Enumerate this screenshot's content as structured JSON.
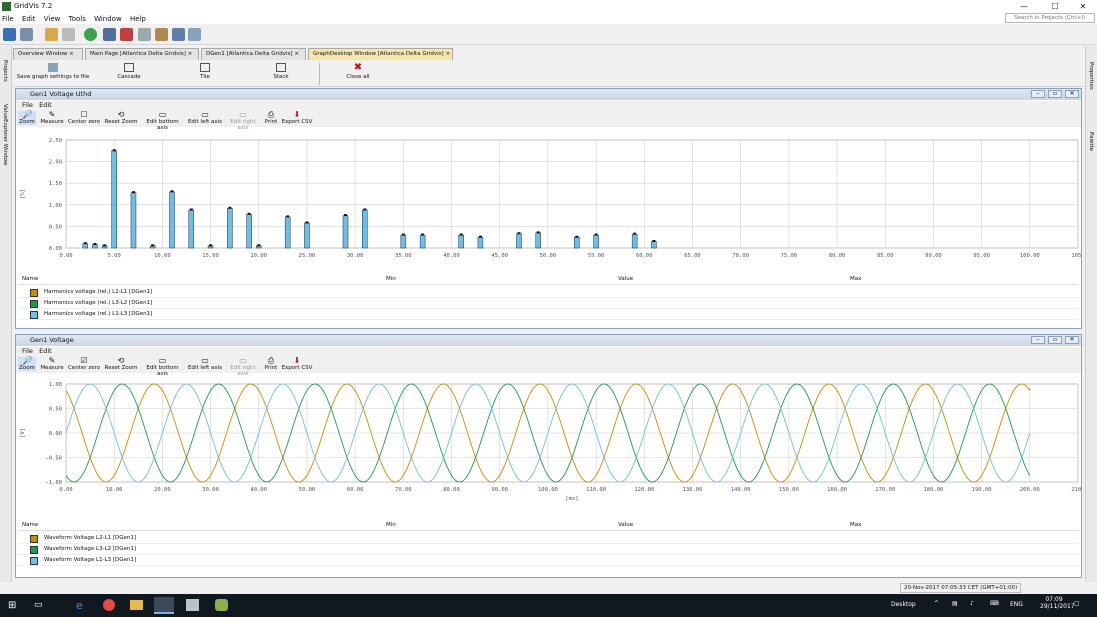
{
  "app": {
    "title": "GridVis 7.2",
    "close_glyph": "✕",
    "min_glyph": "—",
    "max_glyph": "☐"
  },
  "menu": [
    "File",
    "Edit",
    "View",
    "Tools",
    "Window",
    "Help"
  ],
  "search": {
    "placeholder": "Search in Projects (Ctrl+I)"
  },
  "left_strip": [
    "Projects",
    "ValueExplorer Window"
  ],
  "right_strip": [
    "Properties",
    "Palette"
  ],
  "tabs": [
    {
      "label": "Overview Window"
    },
    {
      "label": "Main Page [Atlantica Delta Gridvis]"
    },
    {
      "label": "DGen1 [Atlantica Delta Gridvis]"
    },
    {
      "label": "GraphDesktop Window [Atlantica Delta Gridvis]"
    }
  ],
  "tab_close": "×",
  "actions": [
    {
      "label": "Save graph settings to file"
    },
    {
      "label": "Cascade"
    },
    {
      "label": "Tile"
    },
    {
      "label": "Stack"
    },
    {
      "label": "Close all"
    }
  ],
  "panel_menu": [
    "File",
    "Edit"
  ],
  "panel_tools": [
    {
      "label": "Zoom"
    },
    {
      "label": "Measure"
    },
    {
      "label": "Center zero"
    },
    {
      "label": "Reset Zoom"
    },
    {
      "label": "Edit bottom axis"
    },
    {
      "label": "Edit left axis"
    },
    {
      "label": "Edit right axis"
    },
    {
      "label": "Print"
    },
    {
      "label": "Export CSV"
    }
  ],
  "table_headers": [
    "Name",
    "Min",
    "Value",
    "Max"
  ],
  "colors": {
    "l1": "#c98c00",
    "l2": "#1e9a4a",
    "l3": "#6cc0e8",
    "accent": "#f7e6a9"
  },
  "panel1": {
    "title": "Gen1 Voltage Uthd",
    "legend": [
      {
        "name": "Harmonics voltage (rel.) L2-L1 [DGen1]",
        "color": "#c98c00"
      },
      {
        "name": "Harmonics voltage (rel.) L3-L2 [DGen1]",
        "color": "#1e9a4a"
      },
      {
        "name": "Harmonics voltage (rel.) L1-L3 [DGen1]",
        "color": "#6cc0e8"
      }
    ]
  },
  "panel2": {
    "title": "Gen1 Voltage",
    "legend": [
      {
        "name": "Waveform Voltage L2-L1 [DGen1]",
        "color": "#c98c00"
      },
      {
        "name": "Waveform Voltage L3-L2 [DGen1]",
        "color": "#1e9a4a"
      },
      {
        "name": "Waveform Voltage L1-L3 [DGen1]",
        "color": "#6cc0e8"
      }
    ]
  },
  "status": {
    "timestamp": "20-Nov-2017 07:05:33 CET (GMT+01:00)"
  },
  "taskbar": {
    "desktop": "Desktop",
    "lang": "ENG",
    "time": "07:09",
    "date": "29/11/2017"
  },
  "chart_data": [
    {
      "type": "bar",
      "title": "",
      "xlabel": "",
      "ylabel": "[%]",
      "xlim": [
        0,
        105
      ],
      "ylim": [
        0,
        2.5
      ],
      "x_ticks": [
        "0.00",
        "5.00",
        "10.00",
        "15.00",
        "20.00",
        "25.00",
        "30.00",
        "35.00",
        "40.00",
        "45.00",
        "50.00",
        "55.00",
        "60.00",
        "65.00",
        "70.00",
        "75.00",
        "80.00",
        "85.00",
        "90.00",
        "95.00",
        "100.00",
        "105."
      ],
      "y_ticks": [
        "0.00",
        "0.50",
        "1.00",
        "1.50",
        "2.00",
        "2.50"
      ],
      "x": [
        2,
        3,
        4,
        5,
        7,
        9,
        11,
        13,
        15,
        17,
        19,
        20,
        23,
        25,
        29,
        31,
        35,
        37,
        41,
        43,
        47,
        49,
        53,
        55,
        59,
        61
      ],
      "values": [
        0.1,
        0.08,
        0.05,
        2.25,
        1.28,
        0.05,
        1.3,
        0.88,
        0.05,
        0.92,
        0.78,
        0.05,
        0.72,
        0.58,
        0.75,
        0.88,
        0.3,
        0.3,
        0.3,
        0.25,
        0.33,
        0.35,
        0.25,
        0.3,
        0.32,
        0.15
      ],
      "grid": true
    },
    {
      "type": "line",
      "title": "",
      "xlabel": "[ms]",
      "ylabel": "[V]",
      "xlim": [
        0,
        210
      ],
      "ylim": [
        -1.0,
        1.0
      ],
      "x_ticks": [
        "0.00",
        "10.00",
        "20.00",
        "30.00",
        "40.00",
        "50.00",
        "60.00",
        "70.00",
        "80.00",
        "90.00",
        "100.00",
        "110.00",
        "120.00",
        "130.00",
        "140.00",
        "150.00",
        "160.00",
        "170.00",
        "180.00",
        "190.00",
        "200.00",
        "210."
      ],
      "y_ticks": [
        "-1.00",
        "-0.50",
        "0.00",
        "0.50",
        "1.00"
      ],
      "series": [
        {
          "name": "Waveform Voltage L2-L1 [DGen1]",
          "amplitude": 1.0,
          "period_ms": 20,
          "phase_deg": 120,
          "x_end": 200
        },
        {
          "name": "Waveform Voltage L3-L2 [DGen1]",
          "amplitude": 1.0,
          "period_ms": 20,
          "phase_deg": 240,
          "x_end": 200
        },
        {
          "name": "Waveform Voltage L1-L3 [DGen1]",
          "amplitude": 1.0,
          "period_ms": 20,
          "phase_deg": 0,
          "x_end": 200
        }
      ],
      "grid": true
    }
  ]
}
